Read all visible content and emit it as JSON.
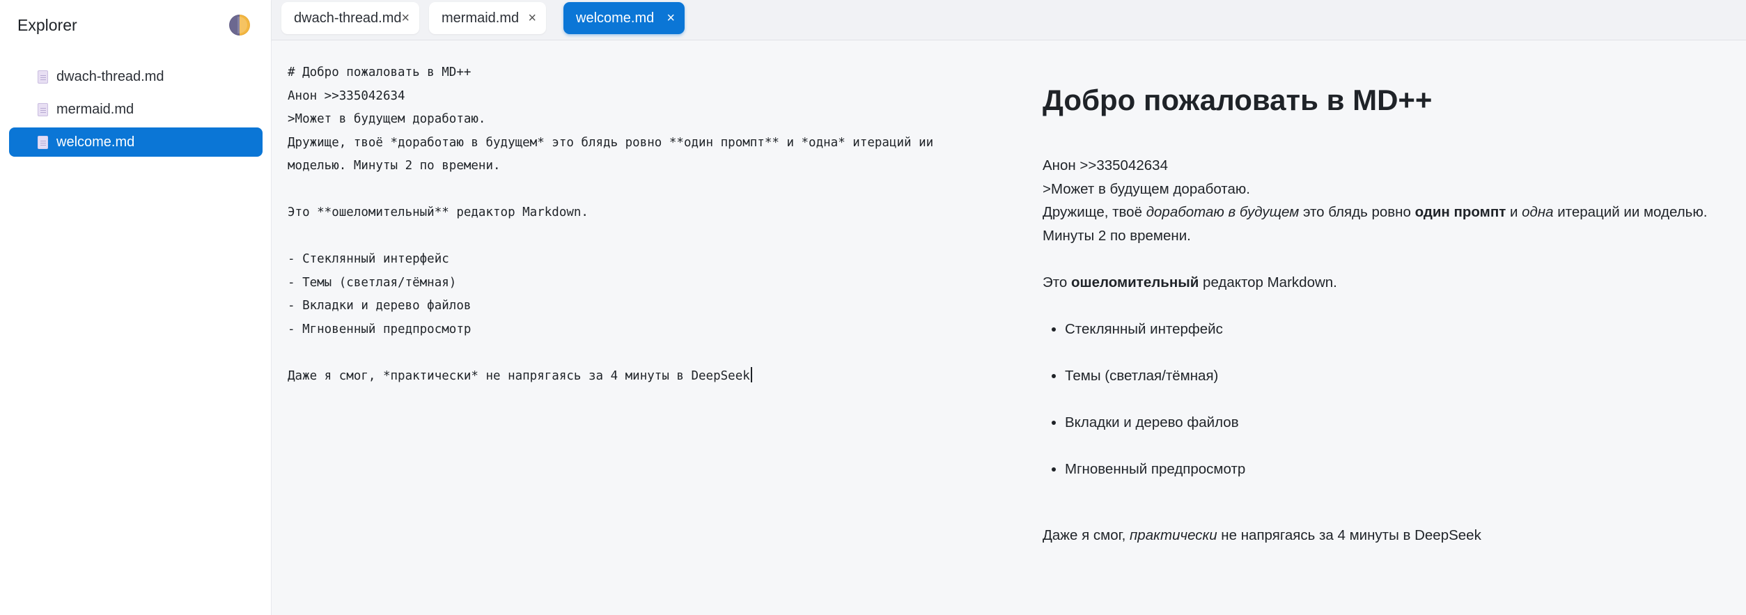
{
  "sidebar": {
    "title": "Explorer",
    "theme_toggle_icon": "half-moon-icon",
    "files": [
      {
        "label": "dwach-thread.md",
        "active": false
      },
      {
        "label": "mermaid.md",
        "active": false
      },
      {
        "label": "welcome.md",
        "active": true
      }
    ]
  },
  "tabs": [
    {
      "label": "dwach-thread.md",
      "close": "×",
      "active": false
    },
    {
      "label": "mermaid.md",
      "close": "×",
      "active": false
    },
    {
      "label": "welcome.md",
      "close": "×",
      "active": true
    }
  ],
  "editor": {
    "lines": [
      "# Добро пожаловать в MD++",
      "Анон >>335042634",
      ">Может в будущем доработаю.",
      "Дружище, твоё *доработаю в будущем* это блядь ровно **один промпт** и *одна* итераций ии",
      "моделью. Минуты 2 по времени.",
      "",
      "Это **ошеломительный** редактор Markdown.",
      "",
      "- Стеклянный интерфейс",
      "- Темы (светлая/тёмная)",
      "- Вкладки и дерево файлов",
      "- Мгновенный предпросмотр",
      "",
      "Даже я смог, *практически* не напрягаясь за 4 минуты в DeepSeek"
    ]
  },
  "preview": {
    "heading": "Добро пожаловать в MD++",
    "quote_author": "Анон >>335042634",
    "quote_text": ">Может в будущем доработаю.",
    "para1_a": "Дружище, твоё ",
    "para1_em1": "доработаю в будущем",
    "para1_b": " это блядь ровно ",
    "para1_strong": "один промпт",
    "para1_c": " и ",
    "para1_em2": "одна",
    "para1_d": " итераций ии моделью.",
    "para1_line2": "Минуты 2 по времени.",
    "para2_a": "Это ",
    "para2_strong": "ошеломительный",
    "para2_b": " редактор Markdown.",
    "bullets": [
      "Стеклянный интерфейс",
      "Темы (светлая/тёмная)",
      "Вкладки и дерево файлов",
      "Мгновенный предпросмотр"
    ],
    "para3_a": "Даже я смог, ",
    "para3_em": "практически",
    "para3_b": " не напрягаясь за 4 минуты в DeepSeek"
  },
  "colors": {
    "accent": "#0b76d6",
    "sidebar_bg": "#ffffff",
    "content_bg": "#f6f7f9"
  }
}
